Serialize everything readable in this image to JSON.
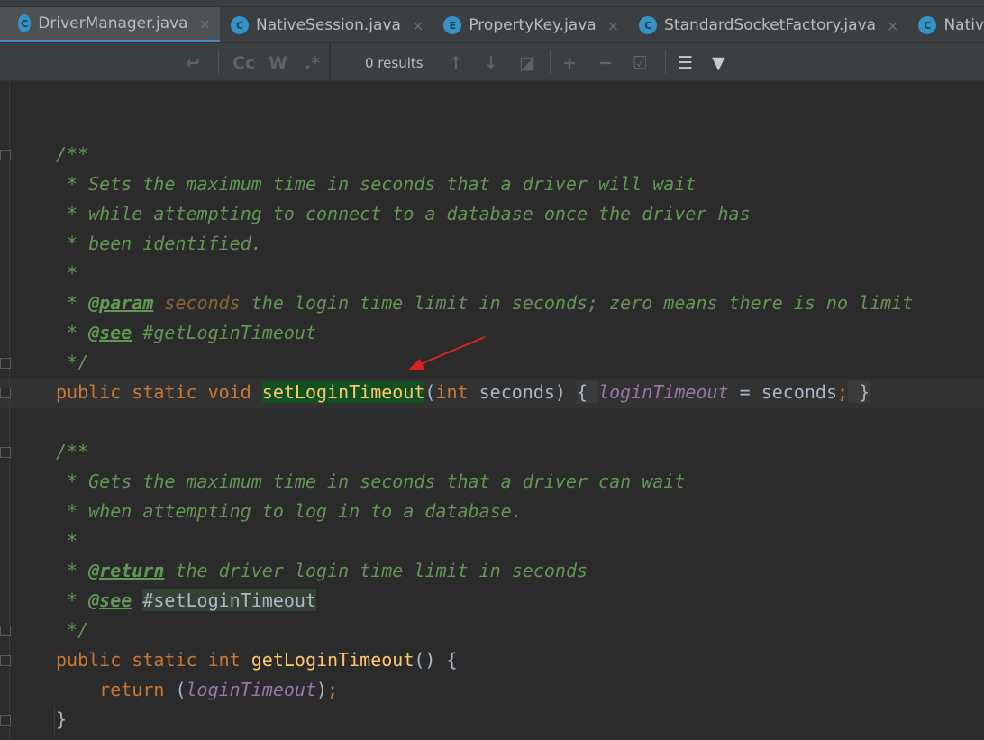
{
  "tabs": [
    {
      "label": "DriverManager.java",
      "icon": "C",
      "active": true
    },
    {
      "label": "NativeSession.java",
      "icon": "C"
    },
    {
      "label": "PropertyKey.java",
      "icon": "E"
    },
    {
      "label": "StandardSocketFactory.java",
      "icon": "C"
    },
    {
      "label": "NativeSession.java",
      "icon": "C"
    }
  ],
  "find": {
    "results": "0 results",
    "cc": "Cc",
    "w": "W",
    "regex": ".*"
  },
  "colors": {
    "accent": "#4a88c7",
    "keyword": "#cc7832",
    "comment": "#629755",
    "method": "#ffc66d",
    "field": "#9876aa",
    "arrow": "#e02020"
  },
  "code": [
    [],
    [],
    [
      [
        "c",
        "/**"
      ]
    ],
    [
      [
        "c",
        " * Sets the maximum time in seconds that a driver will wait"
      ]
    ],
    [
      [
        "c",
        " * while attempting to connect to a database once the driver has"
      ]
    ],
    [
      [
        "c",
        " * been identified."
      ]
    ],
    [
      [
        "c",
        " *"
      ]
    ],
    [
      [
        "c",
        " * "
      ],
      [
        "tag",
        "@param"
      ],
      [
        "c",
        " "
      ],
      [
        "pn",
        "seconds"
      ],
      [
        "c",
        " the login time limit in seconds; zero means there is no limit"
      ]
    ],
    [
      [
        "c",
        " * "
      ],
      [
        "tag",
        "@see"
      ],
      [
        "c",
        " #getLoginTimeout"
      ]
    ],
    [
      [
        "c",
        " */"
      ]
    ],
    [
      [
        "kw",
        "public static void "
      ],
      [
        "fnsel",
        "setLoginTimeout"
      ],
      [
        "txt",
        "("
      ],
      [
        "kw",
        "int "
      ],
      [
        "txt",
        "seconds) "
      ],
      [
        "fold",
        "{ "
      ],
      [
        "fld",
        "loginTimeout"
      ],
      [
        "txt",
        " = seconds"
      ],
      [
        "kw",
        ";"
      ],
      [
        "fold",
        " }"
      ]
    ],
    [],
    [
      [
        "c",
        "/**"
      ]
    ],
    [
      [
        "c",
        " * Gets the maximum time in seconds that a driver can wait"
      ]
    ],
    [
      [
        "c",
        " * when attempting to log in to a database."
      ]
    ],
    [
      [
        "c",
        " *"
      ]
    ],
    [
      [
        "c",
        " * "
      ],
      [
        "tag",
        "@return"
      ],
      [
        "c",
        " the driver login time limit in seconds"
      ]
    ],
    [
      [
        "c",
        " * "
      ],
      [
        "tag",
        "@see"
      ],
      [
        "c",
        " "
      ],
      [
        "refhl",
        "#setLoginTimeout"
      ]
    ],
    [
      [
        "c",
        " */"
      ]
    ],
    [
      [
        "kw",
        "public static int "
      ],
      [
        "fn",
        "getLoginTimeout"
      ],
      [
        "txt",
        "() {"
      ]
    ],
    [
      [
        "kw",
        "    return "
      ],
      [
        "txt",
        "("
      ],
      [
        "fld",
        "loginTimeout"
      ],
      [
        "txt",
        ")"
      ],
      [
        "kw",
        ";"
      ]
    ],
    [
      [
        "txt",
        "}"
      ]
    ]
  ]
}
